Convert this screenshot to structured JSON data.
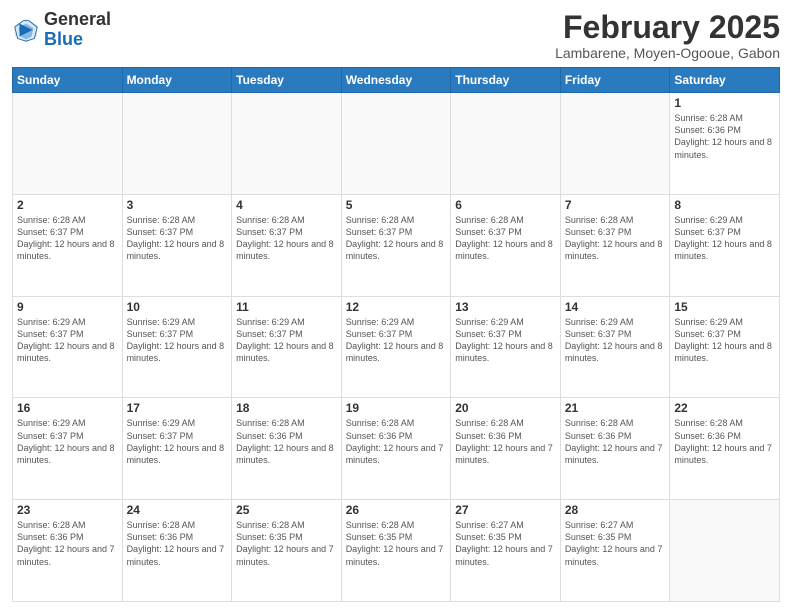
{
  "logo": {
    "general": "General",
    "blue": "Blue"
  },
  "header": {
    "month": "February 2025",
    "location": "Lambarene, Moyen-Ogooue, Gabon"
  },
  "weekdays": [
    "Sunday",
    "Monday",
    "Tuesday",
    "Wednesday",
    "Thursday",
    "Friday",
    "Saturday"
  ],
  "weeks": [
    [
      {
        "day": "",
        "info": ""
      },
      {
        "day": "",
        "info": ""
      },
      {
        "day": "",
        "info": ""
      },
      {
        "day": "",
        "info": ""
      },
      {
        "day": "",
        "info": ""
      },
      {
        "day": "",
        "info": ""
      },
      {
        "day": "1",
        "info": "Sunrise: 6:28 AM\nSunset: 6:36 PM\nDaylight: 12 hours and 8 minutes."
      }
    ],
    [
      {
        "day": "2",
        "info": "Sunrise: 6:28 AM\nSunset: 6:37 PM\nDaylight: 12 hours and 8 minutes."
      },
      {
        "day": "3",
        "info": "Sunrise: 6:28 AM\nSunset: 6:37 PM\nDaylight: 12 hours and 8 minutes."
      },
      {
        "day": "4",
        "info": "Sunrise: 6:28 AM\nSunset: 6:37 PM\nDaylight: 12 hours and 8 minutes."
      },
      {
        "day": "5",
        "info": "Sunrise: 6:28 AM\nSunset: 6:37 PM\nDaylight: 12 hours and 8 minutes."
      },
      {
        "day": "6",
        "info": "Sunrise: 6:28 AM\nSunset: 6:37 PM\nDaylight: 12 hours and 8 minutes."
      },
      {
        "day": "7",
        "info": "Sunrise: 6:28 AM\nSunset: 6:37 PM\nDaylight: 12 hours and 8 minutes."
      },
      {
        "day": "8",
        "info": "Sunrise: 6:29 AM\nSunset: 6:37 PM\nDaylight: 12 hours and 8 minutes."
      }
    ],
    [
      {
        "day": "9",
        "info": "Sunrise: 6:29 AM\nSunset: 6:37 PM\nDaylight: 12 hours and 8 minutes."
      },
      {
        "day": "10",
        "info": "Sunrise: 6:29 AM\nSunset: 6:37 PM\nDaylight: 12 hours and 8 minutes."
      },
      {
        "day": "11",
        "info": "Sunrise: 6:29 AM\nSunset: 6:37 PM\nDaylight: 12 hours and 8 minutes."
      },
      {
        "day": "12",
        "info": "Sunrise: 6:29 AM\nSunset: 6:37 PM\nDaylight: 12 hours and 8 minutes."
      },
      {
        "day": "13",
        "info": "Sunrise: 6:29 AM\nSunset: 6:37 PM\nDaylight: 12 hours and 8 minutes."
      },
      {
        "day": "14",
        "info": "Sunrise: 6:29 AM\nSunset: 6:37 PM\nDaylight: 12 hours and 8 minutes."
      },
      {
        "day": "15",
        "info": "Sunrise: 6:29 AM\nSunset: 6:37 PM\nDaylight: 12 hours and 8 minutes."
      }
    ],
    [
      {
        "day": "16",
        "info": "Sunrise: 6:29 AM\nSunset: 6:37 PM\nDaylight: 12 hours and 8 minutes."
      },
      {
        "day": "17",
        "info": "Sunrise: 6:29 AM\nSunset: 6:37 PM\nDaylight: 12 hours and 8 minutes."
      },
      {
        "day": "18",
        "info": "Sunrise: 6:28 AM\nSunset: 6:36 PM\nDaylight: 12 hours and 8 minutes."
      },
      {
        "day": "19",
        "info": "Sunrise: 6:28 AM\nSunset: 6:36 PM\nDaylight: 12 hours and 7 minutes."
      },
      {
        "day": "20",
        "info": "Sunrise: 6:28 AM\nSunset: 6:36 PM\nDaylight: 12 hours and 7 minutes."
      },
      {
        "day": "21",
        "info": "Sunrise: 6:28 AM\nSunset: 6:36 PM\nDaylight: 12 hours and 7 minutes."
      },
      {
        "day": "22",
        "info": "Sunrise: 6:28 AM\nSunset: 6:36 PM\nDaylight: 12 hours and 7 minutes."
      }
    ],
    [
      {
        "day": "23",
        "info": "Sunrise: 6:28 AM\nSunset: 6:36 PM\nDaylight: 12 hours and 7 minutes."
      },
      {
        "day": "24",
        "info": "Sunrise: 6:28 AM\nSunset: 6:36 PM\nDaylight: 12 hours and 7 minutes."
      },
      {
        "day": "25",
        "info": "Sunrise: 6:28 AM\nSunset: 6:35 PM\nDaylight: 12 hours and 7 minutes."
      },
      {
        "day": "26",
        "info": "Sunrise: 6:28 AM\nSunset: 6:35 PM\nDaylight: 12 hours and 7 minutes."
      },
      {
        "day": "27",
        "info": "Sunrise: 6:27 AM\nSunset: 6:35 PM\nDaylight: 12 hours and 7 minutes."
      },
      {
        "day": "28",
        "info": "Sunrise: 6:27 AM\nSunset: 6:35 PM\nDaylight: 12 hours and 7 minutes."
      },
      {
        "day": "",
        "info": ""
      }
    ]
  ]
}
